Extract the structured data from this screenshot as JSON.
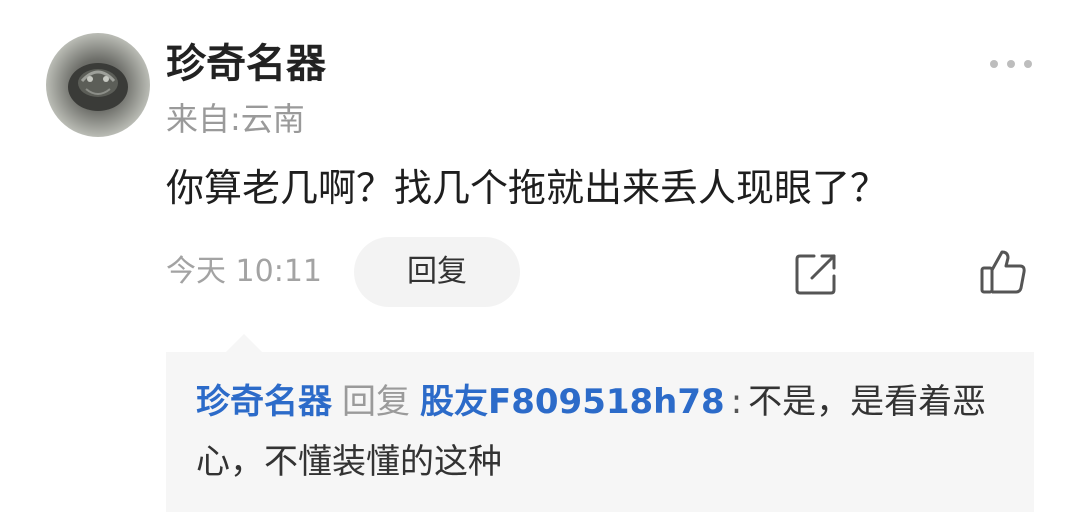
{
  "comment": {
    "author": "珍奇名器",
    "location": "来自:云南",
    "text": "你算老几啊？找几个拖就出来丢人现眼了？",
    "time": "今天 10:11",
    "reply_label": "回复"
  },
  "sub_reply": {
    "author": "珍奇名器",
    "verb": "回复",
    "target": "股友F809518h78",
    "colon": ":",
    "text": "不是，是看着恶心，不懂装懂的这种"
  },
  "icons": {
    "more": "more-icon",
    "share": "share-icon",
    "like": "thumbs-up-icon"
  },
  "colors": {
    "link_blue": "#2c6bc9",
    "muted_gray": "#9a9a9a",
    "reply_bg": "#f6f6f6"
  }
}
